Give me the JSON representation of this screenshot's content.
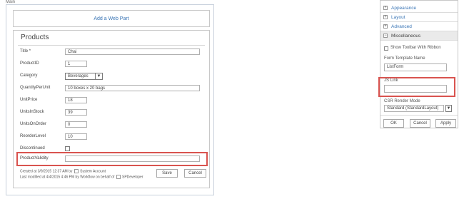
{
  "zone": {
    "label": "Main",
    "add_web_part": "Add a Web Part"
  },
  "form": {
    "title": "Products",
    "fields": [
      {
        "label": "Title *",
        "value": "Chai"
      },
      {
        "label": "ProductID",
        "value": "1"
      },
      {
        "label": "Category",
        "value": "Beverages"
      },
      {
        "label": "QuantityPerUnit",
        "value": "10 boxes x 20 bags"
      },
      {
        "label": "UnitPrice",
        "value": "18"
      },
      {
        "label": "UnitsInStock",
        "value": "39"
      },
      {
        "label": "UnitsOnOrder",
        "value": "0"
      },
      {
        "label": "ReorderLevel",
        "value": "10"
      },
      {
        "label": "Discontinued",
        "value": ""
      },
      {
        "label": "ProductValidity",
        "value": ""
      }
    ],
    "created": {
      "prefix": "Created at 3/9/2015 12:37 AM  by",
      "user": "System Account"
    },
    "modified": {
      "prefix": "Last modified at 4/4/2015 4:46 PM  by Workflow on behalf of",
      "user": "SPDeveloper"
    },
    "save_label": "Save",
    "cancel_label": "Cancel"
  },
  "tool_pane": {
    "sections": [
      {
        "label": "Appearance",
        "toggle": "+"
      },
      {
        "label": "Layout",
        "toggle": "+"
      },
      {
        "label": "Advanced",
        "toggle": "+"
      },
      {
        "label": "Miscellaneous",
        "toggle": "−"
      }
    ],
    "show_toolbar_label": "Show Toolbar With Ribbon",
    "form_template_label": "Form Template Name",
    "form_template_value": "ListForm",
    "js_link_label": "JS Link",
    "js_link_value": "",
    "csr_label": "CSR Render Mode",
    "csr_value": "Standard (StandardLayout)",
    "ok_label": "OK",
    "cancel_label": "Cancel",
    "apply_label": "Apply"
  },
  "colors": {
    "accent_link": "#3a75b5",
    "highlight": "#d9534f",
    "border": "#c8c8c8"
  },
  "icons": {
    "select_arrow": "chevron-down-icon",
    "section_toggle": "expand-collapse-icon"
  }
}
